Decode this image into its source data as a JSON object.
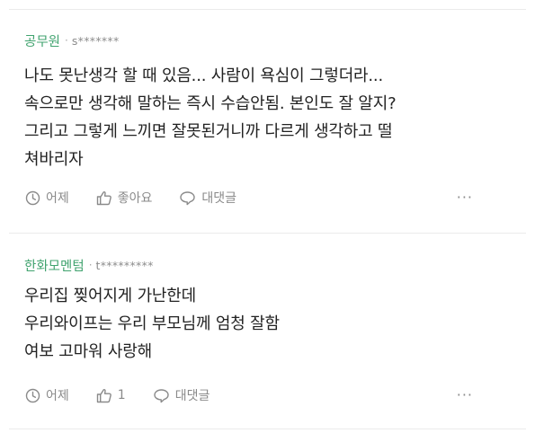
{
  "comments": [
    {
      "nickname": "공무원",
      "separator": "·",
      "user_id": "s*******",
      "lines": [
        "나도 못난생각 할 때 있음... 사람이 욕심이 그렇더라...",
        "속으로만 생각해 말하는 즉시 수습안됨. 본인도 잘 알지?",
        "그리고 그렇게 느끼면 잘못된거니까 다르게 생각하고 떨",
        "쳐바리자"
      ],
      "time": "어제",
      "like_label": "좋아요",
      "reply_label": "대댓글",
      "more": "···"
    },
    {
      "nickname": "한화모멘텀",
      "separator": "·",
      "user_id": "t*********",
      "lines": [
        "우리집 찢어지게 가난한데",
        "우리와이프는 우리 부모님께 엄청 잘함",
        "여보 고마워 사랑해"
      ],
      "time": "어제",
      "like_label": "1",
      "reply_label": "대댓글",
      "more": "···"
    }
  ],
  "icons": {
    "time": "clock-icon",
    "like": "thumbs-up-icon",
    "reply": "speech-bubble-icon",
    "more": "more-dots-icon"
  },
  "colors": {
    "nickname": "#41a36f",
    "meta": "#8c8c8c",
    "body_text": "#222222",
    "action_text": "#8a8a8a",
    "divider": "#ebebeb"
  }
}
